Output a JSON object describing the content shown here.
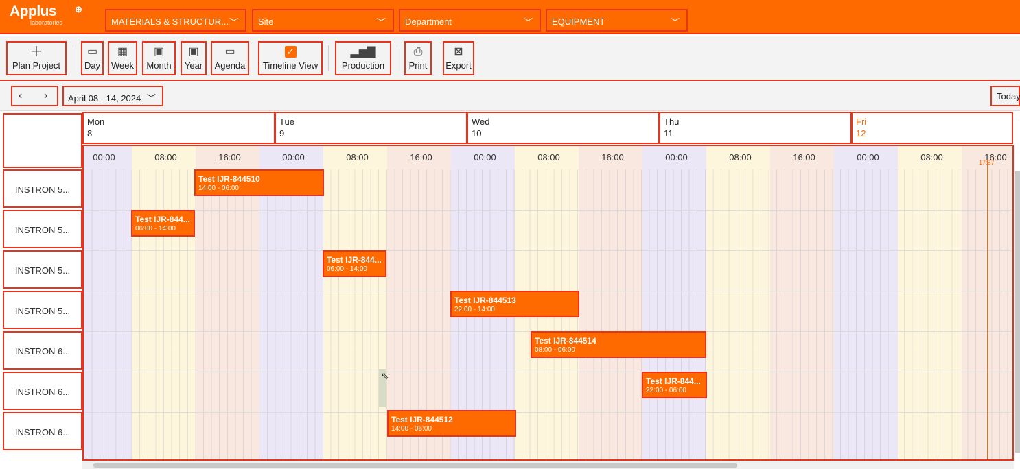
{
  "brand": {
    "logo_text": "Applus",
    "logo_sub": "laboratories",
    "logo_mark": "⊕"
  },
  "colors": {
    "accent": "#ff6a00",
    "highlight_border": "#e8341c",
    "band_purple": "#ebe7f7",
    "band_yellow": "#fdf6dc",
    "band_pink": "#f9e8e0"
  },
  "filters": [
    {
      "label": "MATERIALS & STRUCTUR...",
      "icon": "chevron-down-icon"
    },
    {
      "label": "Site",
      "icon": "chevron-down-icon"
    },
    {
      "label": "Department",
      "icon": "chevron-down-icon"
    },
    {
      "label": "EQUIPMENT",
      "icon": "chevron-down-icon"
    }
  ],
  "toolbar": {
    "plan_project": "Plan Project",
    "day": "Day",
    "week": "Week",
    "month": "Month",
    "year": "Year",
    "agenda": "Agenda",
    "timeline_view": "Timeline View",
    "production": "Production",
    "print": "Print",
    "export": "Export"
  },
  "nav": {
    "prev": "‹",
    "next": "›",
    "date_range": "April 08 - 14, 2024",
    "today": "Today"
  },
  "days": [
    {
      "name": "Mon",
      "num": "8"
    },
    {
      "name": "Tue",
      "num": "9"
    },
    {
      "name": "Wed",
      "num": "10"
    },
    {
      "name": "Thu",
      "num": "11"
    },
    {
      "name": "Fri",
      "num": "12"
    }
  ],
  "ticks": [
    "00:00",
    "08:00",
    "16:00",
    "00:00",
    "08:00",
    "16:00",
    "00:00",
    "08:00",
    "16:00",
    "00:00",
    "08:00",
    "16:00",
    "00:00",
    "08:00",
    "16:00"
  ],
  "now_label": "17:57",
  "resources": [
    "INSTRON 5...",
    "INSTRON 5...",
    "INSTRON 5...",
    "INSTRON 5...",
    "INSTRON 6...",
    "INSTRON 6...",
    "INSTRON 6..."
  ],
  "events": [
    {
      "title": "Test IJR-844510",
      "time": "14:00 - 06:00"
    },
    {
      "title": "Test IJR-844...",
      "time": "06:00 - 14:00"
    },
    {
      "title": "Test IJR-844...",
      "time": "06:00 - 14:00"
    },
    {
      "title": "Test IJR-844513",
      "time": "22:00 - 14:00"
    },
    {
      "title": "Test IJR-844514",
      "time": "08:00 - 06:00"
    },
    {
      "title": "Test IJR-844...",
      "time": "22:00 - 06:00"
    },
    {
      "title": "Test IJR-844512",
      "time": "14:00 - 06:00"
    }
  ]
}
